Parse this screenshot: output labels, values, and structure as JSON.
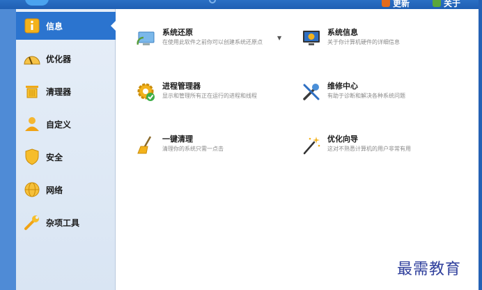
{
  "header": {
    "update_label": "更新",
    "about_label": "关于",
    "accent": "#1f5fb3"
  },
  "sidebar": {
    "items": [
      {
        "label": "信息",
        "icon": "info-icon",
        "active": true
      },
      {
        "label": "优化器",
        "icon": "speedometer-icon",
        "active": false
      },
      {
        "label": "清理器",
        "icon": "trash-bin-icon",
        "active": false
      },
      {
        "label": "自定义",
        "icon": "user-icon",
        "active": false
      },
      {
        "label": "安全",
        "icon": "shield-icon",
        "active": false
      },
      {
        "label": "网络",
        "icon": "globe-icon",
        "active": false
      },
      {
        "label": "杂项工具",
        "icon": "wrench-icon",
        "active": false
      }
    ]
  },
  "main": {
    "tiles": [
      {
        "title": "系统还原",
        "desc": "在使用此软件之前你可以创建系统还原点",
        "icon": "system-restore-icon"
      },
      {
        "title": "系统信息",
        "desc": "关于你计算机硬件的详细信息",
        "icon": "system-info-icon"
      },
      {
        "title": "进程管理器",
        "desc": "显示和管理所有正在运行的进程和线程",
        "icon": "process-manager-icon"
      },
      {
        "title": "维修中心",
        "desc": "有助于诊断和解决各种系统问题",
        "icon": "repair-center-icon"
      },
      {
        "title": "一键清理",
        "desc": "清理你的系统只需一点击",
        "icon": "broom-icon"
      },
      {
        "title": "优化向导",
        "desc": "这对不熟悉计算机的用户非常有用",
        "icon": "magic-wand-icon"
      }
    ]
  },
  "watermark": "最需教育"
}
